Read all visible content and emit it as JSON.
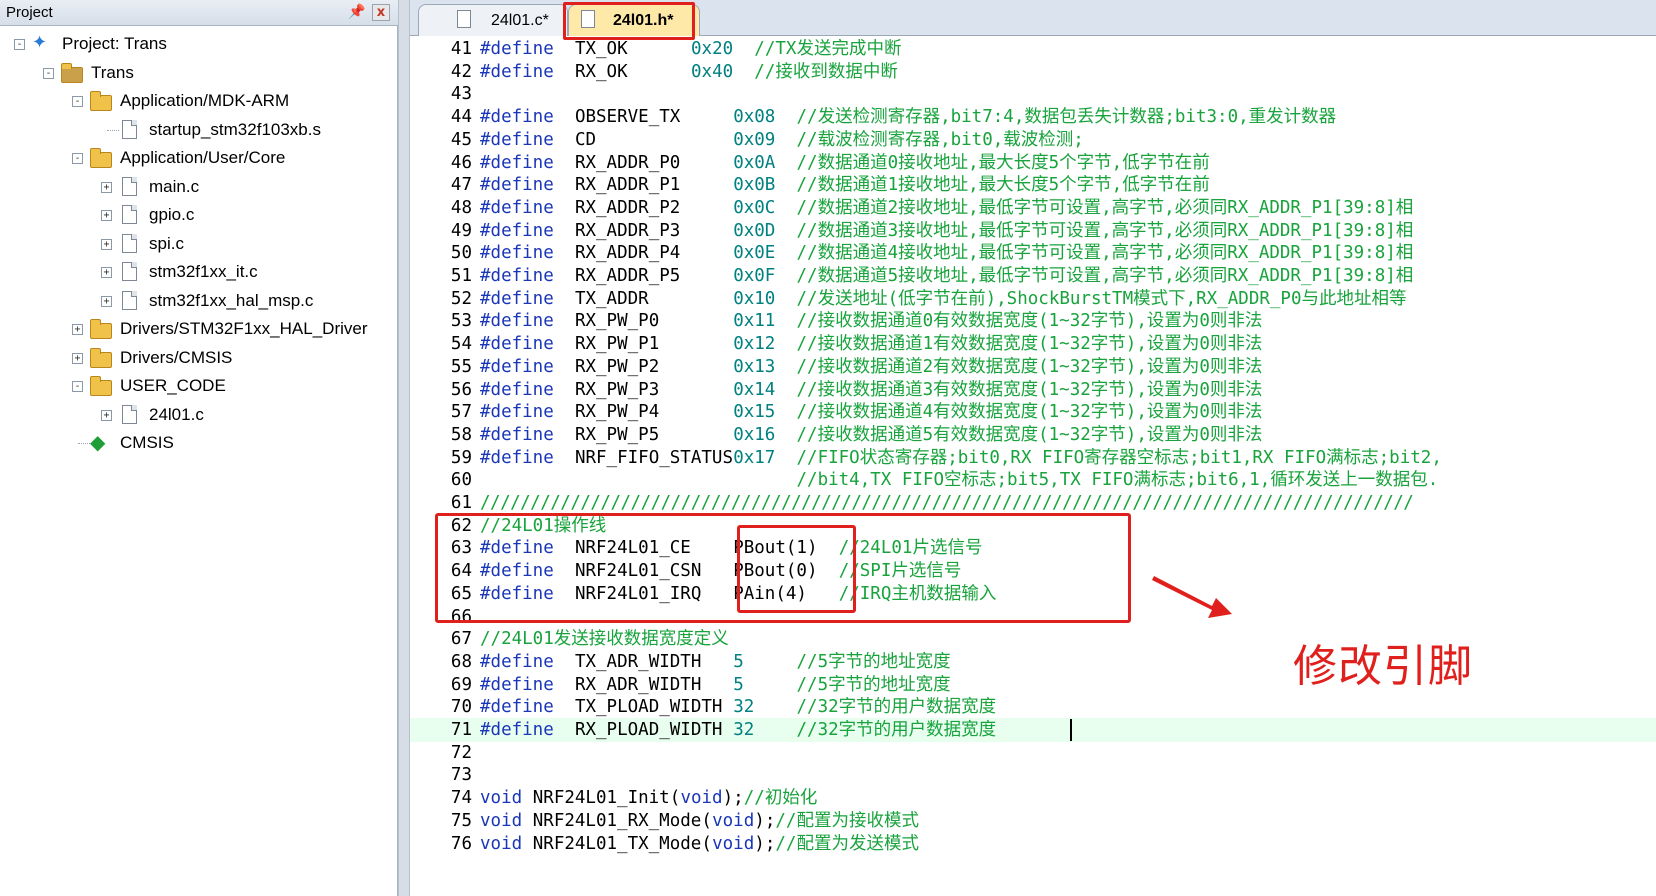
{
  "project_panel": {
    "title": "Project",
    "pin_icon": "pin-icon",
    "close_label": "x",
    "tree": [
      {
        "label": "Project: Trans",
        "type": "project",
        "level": 0,
        "toggle": "-"
      },
      {
        "label": "Trans",
        "type": "target",
        "level": 1,
        "toggle": "-"
      },
      {
        "label": "Application/MDK-ARM",
        "type": "folder",
        "level": 2,
        "toggle": "-"
      },
      {
        "label": "startup_stm32f103xb.s",
        "type": "file",
        "level": 3,
        "toggle": ""
      },
      {
        "label": "Application/User/Core",
        "type": "folder",
        "level": 2,
        "toggle": "-"
      },
      {
        "label": "main.c",
        "type": "file",
        "level": 3,
        "toggle": "+"
      },
      {
        "label": "gpio.c",
        "type": "file",
        "level": 3,
        "toggle": "+"
      },
      {
        "label": "spi.c",
        "type": "file",
        "level": 3,
        "toggle": "+"
      },
      {
        "label": "stm32f1xx_it.c",
        "type": "file",
        "level": 3,
        "toggle": "+"
      },
      {
        "label": "stm32f1xx_hal_msp.c",
        "type": "file",
        "level": 3,
        "toggle": "+"
      },
      {
        "label": "Drivers/STM32F1xx_HAL_Driver",
        "type": "folder",
        "level": 2,
        "toggle": "+"
      },
      {
        "label": "Drivers/CMSIS",
        "type": "folder",
        "level": 2,
        "toggle": "+"
      },
      {
        "label": "USER_CODE",
        "type": "folder",
        "level": 2,
        "toggle": "-"
      },
      {
        "label": "24l01.c",
        "type": "file",
        "level": 3,
        "toggle": "+"
      },
      {
        "label": "CMSIS",
        "type": "cmsis",
        "level": 2,
        "toggle": ""
      }
    ]
  },
  "tabs": [
    {
      "label": "24l01.c*",
      "active": false
    },
    {
      "label": "24l01.h*",
      "active": true
    }
  ],
  "editor": {
    "lines": [
      {
        "n": "41",
        "tokens": [
          [
            "#define",
            "kw",
            0
          ],
          [
            "TX_OK",
            "txt",
            9
          ],
          [
            "0x20",
            "num",
            20
          ],
          [
            "//TX发送完成中断",
            "cmt",
            26
          ]
        ]
      },
      {
        "n": "42",
        "tokens": [
          [
            "#define",
            "kw",
            0
          ],
          [
            "RX_OK",
            "txt",
            9
          ],
          [
            "0x40",
            "num",
            20
          ],
          [
            "//接收到数据中断",
            "cmt",
            26
          ]
        ]
      },
      {
        "n": "43",
        "tokens": []
      },
      {
        "n": "44",
        "tokens": [
          [
            "#define",
            "kw",
            0
          ],
          [
            "OBSERVE_TX",
            "txt",
            9
          ],
          [
            "0x08",
            "num",
            24
          ],
          [
            "//发送检测寄存器,bit7:4,数据包丢失计数器;bit3:0,重发计数器",
            "cmt",
            30
          ]
        ]
      },
      {
        "n": "45",
        "tokens": [
          [
            "#define",
            "kw",
            0
          ],
          [
            "CD",
            "txt",
            9
          ],
          [
            "0x09",
            "num",
            24
          ],
          [
            "//载波检测寄存器,bit0,载波检测;",
            "cmt",
            30
          ]
        ]
      },
      {
        "n": "46",
        "tokens": [
          [
            "#define",
            "kw",
            0
          ],
          [
            "RX_ADDR_P0",
            "txt",
            9
          ],
          [
            "0x0A",
            "num",
            24
          ],
          [
            "//数据通道0接收地址,最大长度5个字节,低字节在前",
            "cmt",
            30
          ]
        ]
      },
      {
        "n": "47",
        "tokens": [
          [
            "#define",
            "kw",
            0
          ],
          [
            "RX_ADDR_P1",
            "txt",
            9
          ],
          [
            "0x0B",
            "num",
            24
          ],
          [
            "//数据通道1接收地址,最大长度5个字节,低字节在前",
            "cmt",
            30
          ]
        ]
      },
      {
        "n": "48",
        "tokens": [
          [
            "#define",
            "kw",
            0
          ],
          [
            "RX_ADDR_P2",
            "txt",
            9
          ],
          [
            "0x0C",
            "num",
            24
          ],
          [
            "//数据通道2接收地址,最低字节可设置,高字节,必须同RX_ADDR_P1[39:8]相",
            "cmt",
            30
          ]
        ]
      },
      {
        "n": "49",
        "tokens": [
          [
            "#define",
            "kw",
            0
          ],
          [
            "RX_ADDR_P3",
            "txt",
            9
          ],
          [
            "0x0D",
            "num",
            24
          ],
          [
            "//数据通道3接收地址,最低字节可设置,高字节,必须同RX_ADDR_P1[39:8]相",
            "cmt",
            30
          ]
        ]
      },
      {
        "n": "50",
        "tokens": [
          [
            "#define",
            "kw",
            0
          ],
          [
            "RX_ADDR_P4",
            "txt",
            9
          ],
          [
            "0x0E",
            "num",
            24
          ],
          [
            "//数据通道4接收地址,最低字节可设置,高字节,必须同RX_ADDR_P1[39:8]相",
            "cmt",
            30
          ]
        ]
      },
      {
        "n": "51",
        "tokens": [
          [
            "#define",
            "kw",
            0
          ],
          [
            "RX_ADDR_P5",
            "txt",
            9
          ],
          [
            "0x0F",
            "num",
            24
          ],
          [
            "//数据通道5接收地址,最低字节可设置,高字节,必须同RX_ADDR_P1[39:8]相",
            "cmt",
            30
          ]
        ]
      },
      {
        "n": "52",
        "tokens": [
          [
            "#define",
            "kw",
            0
          ],
          [
            "TX_ADDR",
            "txt",
            9
          ],
          [
            "0x10",
            "num",
            24
          ],
          [
            "//发送地址(低字节在前),ShockBurstTM模式下,RX_ADDR_P0与此地址相等",
            "cmt",
            30
          ]
        ]
      },
      {
        "n": "53",
        "tokens": [
          [
            "#define",
            "kw",
            0
          ],
          [
            "RX_PW_P0",
            "txt",
            9
          ],
          [
            "0x11",
            "num",
            24
          ],
          [
            "//接收数据通道0有效数据宽度(1~32字节),设置为0则非法",
            "cmt",
            30
          ]
        ]
      },
      {
        "n": "54",
        "tokens": [
          [
            "#define",
            "kw",
            0
          ],
          [
            "RX_PW_P1",
            "txt",
            9
          ],
          [
            "0x12",
            "num",
            24
          ],
          [
            "//接收数据通道1有效数据宽度(1~32字节),设置为0则非法",
            "cmt",
            30
          ]
        ]
      },
      {
        "n": "55",
        "tokens": [
          [
            "#define",
            "kw",
            0
          ],
          [
            "RX_PW_P2",
            "txt",
            9
          ],
          [
            "0x13",
            "num",
            24
          ],
          [
            "//接收数据通道2有效数据宽度(1~32字节),设置为0则非法",
            "cmt",
            30
          ]
        ]
      },
      {
        "n": "56",
        "tokens": [
          [
            "#define",
            "kw",
            0
          ],
          [
            "RX_PW_P3",
            "txt",
            9
          ],
          [
            "0x14",
            "num",
            24
          ],
          [
            "//接收数据通道3有效数据宽度(1~32字节),设置为0则非法",
            "cmt",
            30
          ]
        ]
      },
      {
        "n": "57",
        "tokens": [
          [
            "#define",
            "kw",
            0
          ],
          [
            "RX_PW_P4",
            "txt",
            9
          ],
          [
            "0x15",
            "num",
            24
          ],
          [
            "//接收数据通道4有效数据宽度(1~32字节),设置为0则非法",
            "cmt",
            30
          ]
        ]
      },
      {
        "n": "58",
        "tokens": [
          [
            "#define",
            "kw",
            0
          ],
          [
            "RX_PW_P5",
            "txt",
            9
          ],
          [
            "0x16",
            "num",
            24
          ],
          [
            "//接收数据通道5有效数据宽度(1~32字节),设置为0则非法",
            "cmt",
            30
          ]
        ]
      },
      {
        "n": "59",
        "tokens": [
          [
            "#define",
            "kw",
            0
          ],
          [
            "NRF_FIFO_STATUS",
            "txt",
            9
          ],
          [
            "0x17",
            "num",
            24
          ],
          [
            "//FIFO状态寄存器;bit0,RX FIFO寄存器空标志;bit1,RX FIFO满标志;bit2,",
            "cmt",
            30
          ]
        ]
      },
      {
        "n": "60",
        "tokens": [
          [
            "//bit4,TX FIFO空标志;bit5,TX FIFO满标志;bit6,1,循环发送上一数据包.",
            "cmt",
            30
          ]
        ]
      },
      {
        "n": "61",
        "tokens": [
          [
            "/////////////////////////////////////////////////////////////////////////////////////////////",
            "slashes",
            0
          ]
        ]
      },
      {
        "n": "62",
        "tokens": [
          [
            "//24L01操作线",
            "cmt",
            0
          ]
        ]
      },
      {
        "n": "63",
        "tokens": [
          [
            "#define",
            "kw",
            0
          ],
          [
            "NRF24L01_CE",
            "txt",
            9
          ],
          [
            "PBout(1)",
            "txt",
            24
          ],
          [
            "//24L01片选信号",
            "cmt",
            34
          ]
        ]
      },
      {
        "n": "64",
        "tokens": [
          [
            "#define",
            "kw",
            0
          ],
          [
            "NRF24L01_CSN",
            "txt",
            9
          ],
          [
            "PBout(0)",
            "txt",
            24
          ],
          [
            "//SPI片选信号",
            "cmt",
            34
          ]
        ]
      },
      {
        "n": "65",
        "tokens": [
          [
            "#define",
            "kw",
            0
          ],
          [
            "NRF24L01_IRQ",
            "txt",
            9
          ],
          [
            "PAin(4)",
            "txt",
            24
          ],
          [
            "//IRQ主机数据输入",
            "cmt",
            34
          ]
        ]
      },
      {
        "n": "66",
        "tokens": []
      },
      {
        "n": "67",
        "tokens": [
          [
            "//24L01发送接收数据宽度定义",
            "cmt",
            0
          ]
        ]
      },
      {
        "n": "68",
        "tokens": [
          [
            "#define",
            "kw",
            0
          ],
          [
            "TX_ADR_WIDTH",
            "txt",
            9
          ],
          [
            "5",
            "num",
            24
          ],
          [
            "//5字节的地址宽度",
            "cmt",
            30
          ]
        ]
      },
      {
        "n": "69",
        "tokens": [
          [
            "#define",
            "kw",
            0
          ],
          [
            "RX_ADR_WIDTH",
            "txt",
            9
          ],
          [
            "5",
            "num",
            24
          ],
          [
            "//5字节的地址宽度",
            "cmt",
            30
          ]
        ]
      },
      {
        "n": "70",
        "tokens": [
          [
            "#define",
            "kw",
            0
          ],
          [
            "TX_PLOAD_WIDTH",
            "txt",
            9
          ],
          [
            "32",
            "num",
            24
          ],
          [
            "//32字节的用户数据宽度",
            "cmt",
            30
          ]
        ]
      },
      {
        "n": "71",
        "tokens": [
          [
            "#define",
            "kw",
            0
          ],
          [
            "RX_PLOAD_WIDTH",
            "txt",
            9
          ],
          [
            "32",
            "num",
            24
          ],
          [
            "//32字节的用户数据宽度",
            "cmt",
            30
          ]
        ],
        "current": true
      },
      {
        "n": "72",
        "tokens": []
      },
      {
        "n": "73",
        "tokens": []
      },
      {
        "n": "74",
        "tokens": [
          [
            "void",
            "kw",
            0
          ],
          [
            "NRF24L01_Init(",
            "txt",
            5
          ],
          [
            "void",
            "kw",
            19
          ],
          [
            ");",
            "txt",
            23
          ],
          [
            "//初始化",
            "cmt",
            25
          ]
        ]
      },
      {
        "n": "75",
        "tokens": [
          [
            "void",
            "kw",
            0
          ],
          [
            "NRF24L01_RX_Mode(",
            "txt",
            5
          ],
          [
            "void",
            "kw",
            22
          ],
          [
            ");",
            "txt",
            26
          ],
          [
            "//配置为接收模式",
            "cmt",
            28
          ]
        ]
      },
      {
        "n": "76",
        "tokens": [
          [
            "void",
            "kw",
            0
          ],
          [
            "NRF24L01_TX_Mode(",
            "txt",
            5
          ],
          [
            "void",
            "kw",
            22
          ],
          [
            ");",
            "txt",
            26
          ],
          [
            "//配置为发送模式",
            "cmt",
            28
          ]
        ]
      }
    ]
  },
  "annotation": {
    "text": "修改引脚",
    "color": "#e0201c"
  }
}
